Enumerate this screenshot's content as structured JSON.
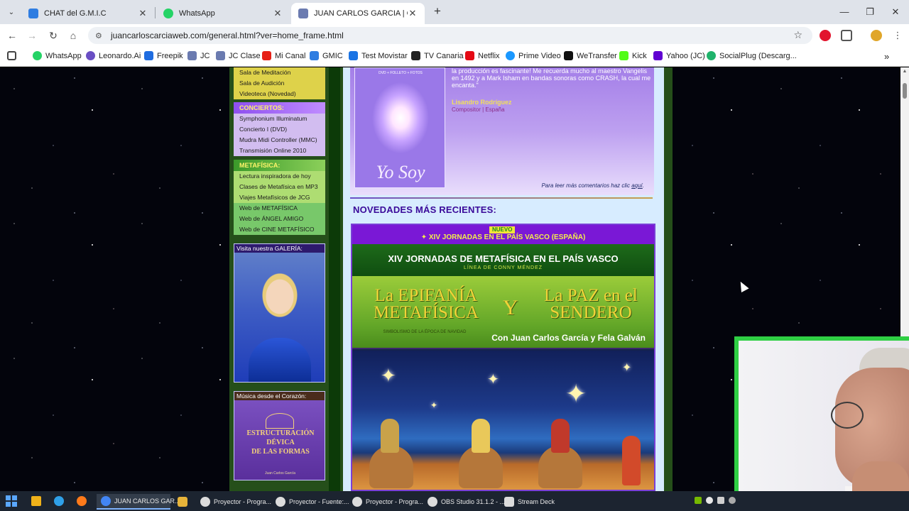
{
  "browser": {
    "tabs": [
      {
        "label": "CHAT del G.M.I.C",
        "favicon_color": "#2f7de1"
      },
      {
        "label": "WhatsApp",
        "favicon_color": "#25d366"
      },
      {
        "label": "JUAN CARLOS GARCIA | Compo",
        "favicon_color": "#6b7bb0"
      }
    ],
    "new_tab": "+",
    "window_controls": {
      "minimize": "—",
      "restore": "❐",
      "close": "✕"
    },
    "nav": {
      "back": "←",
      "forward": "→",
      "reload": "↻",
      "home": "⌂"
    },
    "url": "juancarloscarciaweb.com/general.html?ver=home_frame.html",
    "bookmarks": [
      {
        "label": "WhatsApp",
        "color": "#25d366"
      },
      {
        "label": "Leonardo.Ai",
        "color": "#6a4fc4"
      },
      {
        "label": "Freepik",
        "color": "#1f6ce0"
      },
      {
        "label": "JC",
        "color": "#6b7bb0"
      },
      {
        "label": "JC Clase",
        "color": "#6b7bb0"
      },
      {
        "label": "Mi Canal",
        "color": "#e62117"
      },
      {
        "label": "GMIC",
        "color": "#2f7de1"
      },
      {
        "label": "Test Movistar",
        "color": "#1b74e4"
      },
      {
        "label": "TV Canaria",
        "color": "#222222"
      },
      {
        "label": "Netflix",
        "color": "#e50914"
      },
      {
        "label": "Prime Video",
        "color": "#1a98ff"
      },
      {
        "label": "WeTransfer",
        "color": "#111111"
      },
      {
        "label": "Kick",
        "color": "#53fc18"
      },
      {
        "label": "Yahoo (JC)",
        "color": "#6001d2"
      },
      {
        "label": "SocialPlug (Descarg...",
        "color": "#1fb36b"
      }
    ],
    "bookmarks_more": "»"
  },
  "sidebar": {
    "top_items": [
      "Sala de Meditación",
      "Sala de Audición",
      "Videoteca (Novedad)"
    ],
    "conciertos": {
      "heading": "CONCIERTOS:",
      "items": [
        "Symphonium Illuminatum",
        "Concierto I (DVD)",
        "Mudra Midi Controller (MMC)",
        "Transmisión Online 2010"
      ]
    },
    "metafisica": {
      "heading": "METAFÍSICA:",
      "items": [
        "Lectura inspiradora de hoy",
        "Clases de Metafísica en MP3",
        "Viajes Metafísicos de JCG"
      ],
      "highlight_items": [
        "Web de METAFÍSICA",
        "Web de ÁNGEL AMIGO",
        "Web de CINE METAFÍSICO"
      ]
    },
    "gallery_title": "Visita nuestra GALERÍA:",
    "music_title": "Música desde el Corazón:",
    "book": {
      "title_lines": [
        "ESTRUCTURACIÓN",
        "DÉVICA",
        "DE LAS FORMAS"
      ],
      "author": "Juan Carlos García"
    }
  },
  "main": {
    "cd_top_text": "DVD + FOLLETO + FOTOS",
    "cd_script": "Yo Soy",
    "quote": "la producción es fascinante! Me recuerda mucho al maestro Vangelis en 1492 y a Mark Isham en bandas sonoras como CRASH, la cual me encanta.\"",
    "author": "Lisandro Rodríguez",
    "author_sub": "Compositor | España",
    "more_prefix": "Para leer más comentarios haz clic ",
    "more_link": "aquí",
    "more_suffix": ".",
    "section_title": "NOVEDADES MÁS RECIENTES:"
  },
  "banner": {
    "badge": "NUEVO",
    "top_line": "XIV JORNADAS EN EL PAÍS VASCO (ESPAÑA)",
    "event_title": "XIV JORNADAS DE METAFÍSICA EN EL PAÍS VASCO",
    "event_sub": "LÍNEA DE CONNY MÉNDEZ",
    "title_left": "La EPIFANÍA METAFÍSICA",
    "title_y": "Y",
    "title_right": "La PAZ en el SENDERO",
    "subtitle": "SIMBOLISMO DE LA ÉPOCA DE NAVIDAD",
    "with": "Con Juan Carlos García y Fela Galván"
  },
  "taskbar": {
    "items": [
      {
        "label": "JUAN CARLOS GAR...",
        "color": "#4285f4"
      },
      {
        "label": "",
        "color": "#e8b43a"
      },
      {
        "label": "Proyector - Progra...",
        "color": "#dcdcdc"
      },
      {
        "label": "Proyector - Fuente:...",
        "color": "#dcdcdc"
      },
      {
        "label": "Proyector - Progra...",
        "color": "#dcdcdc"
      },
      {
        "label": "OBS Studio 31.1.2 - ...",
        "color": "#dcdcdc"
      },
      {
        "label": "Stream Deck",
        "color": "#dcdcdc"
      }
    ]
  }
}
